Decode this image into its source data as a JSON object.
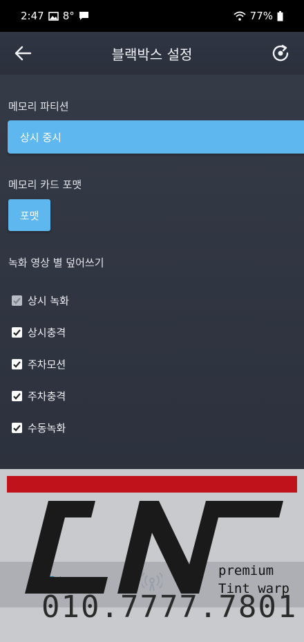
{
  "status_bar": {
    "time": "2:47",
    "temp": "8°",
    "battery": "77%"
  },
  "app_bar": {
    "title": "블랙박스 설정"
  },
  "memory_partition": {
    "label": "메모리 파티션",
    "value": "상시 중시"
  },
  "memory_card": {
    "label": "메모리 카드 포맷",
    "button": "포맷"
  },
  "overwrite": {
    "label": "녹화 영상 별 덮어쓰기",
    "options": [
      {
        "label": "상시 녹화",
        "checked": true,
        "disabled": true
      },
      {
        "label": "상시충격",
        "checked": true,
        "disabled": false
      },
      {
        "label": "주차모션",
        "checked": true,
        "disabled": false
      },
      {
        "label": "주차충격",
        "checked": true,
        "disabled": false
      },
      {
        "label": "수동녹화",
        "checked": true,
        "disabled": false
      }
    ]
  },
  "watermark": {
    "brand_line1": "premium",
    "brand_line2": "Tint warp",
    "phone": "010.7777.7801"
  },
  "colors": {
    "accent": "#5fb7f0",
    "background": "#2e3340",
    "red": "#c0121a"
  }
}
